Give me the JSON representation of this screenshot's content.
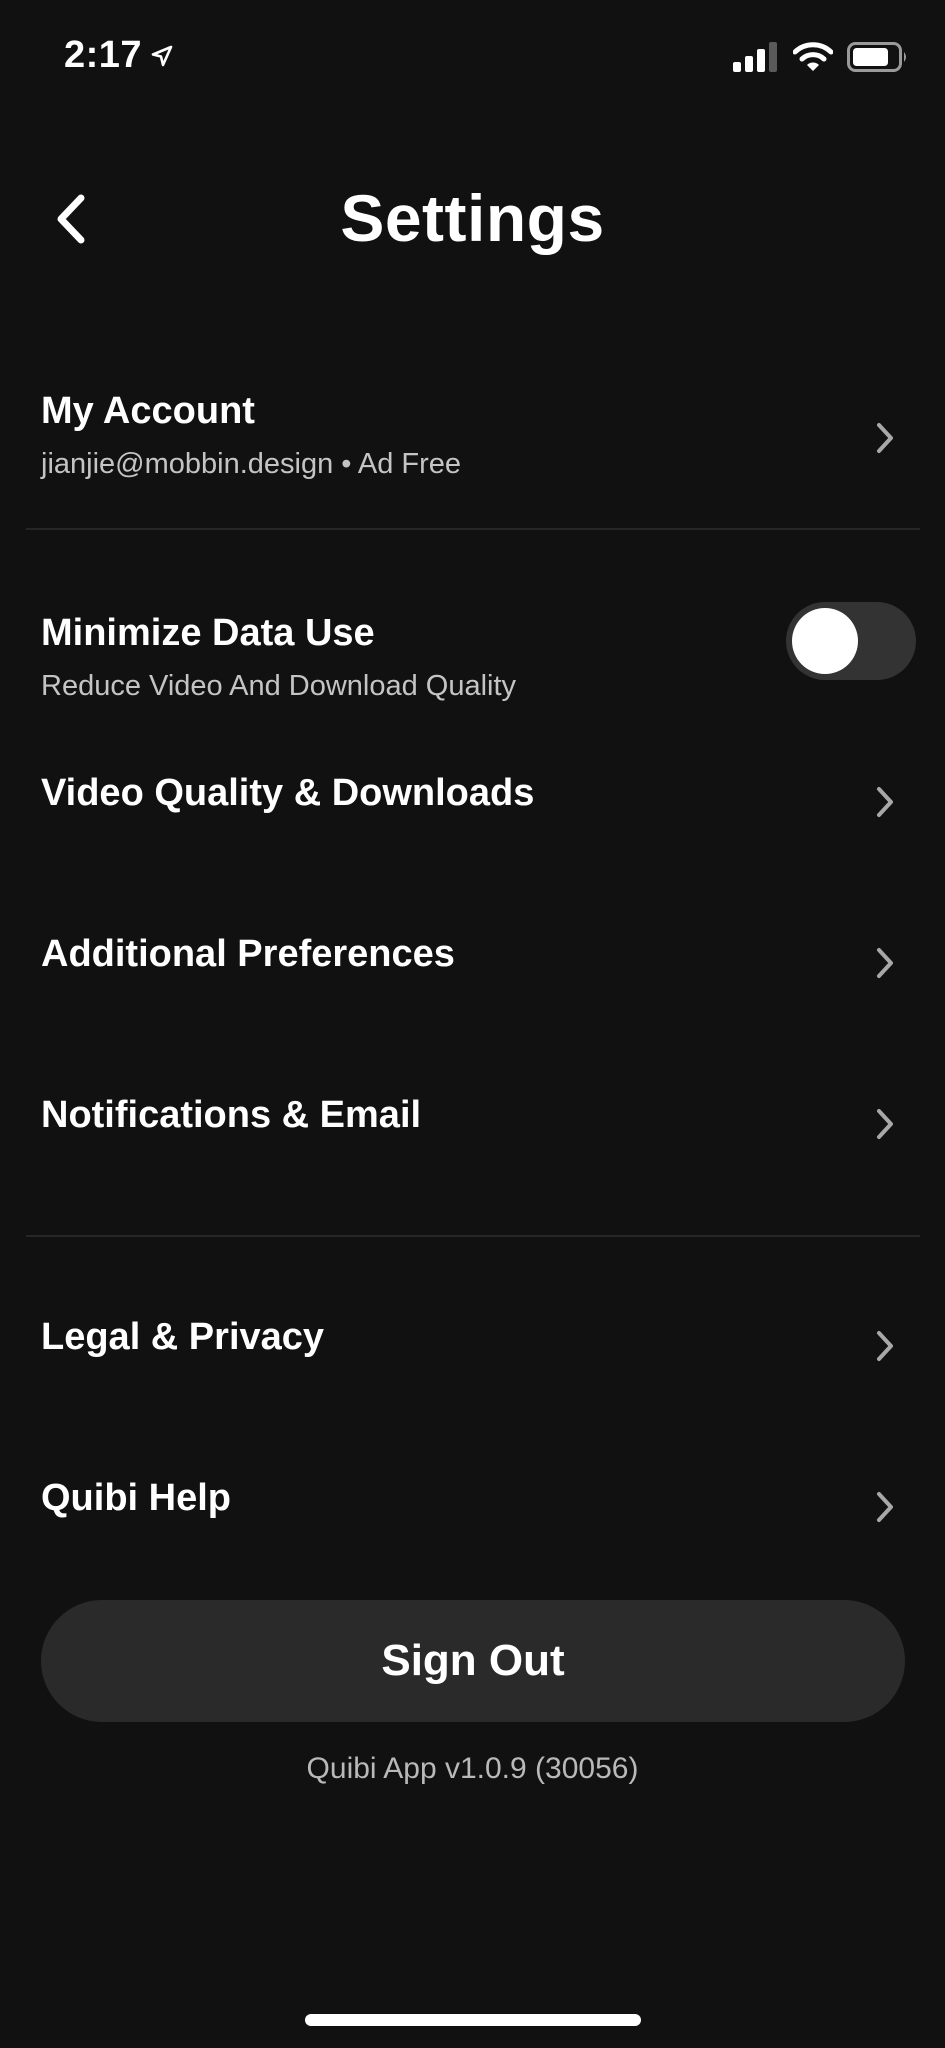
{
  "status_bar": {
    "time": "2:17",
    "location_icon": "location-arrow-icon",
    "signal_icon": "cellular-signal-icon",
    "wifi_icon": "wifi-icon",
    "battery_icon": "battery-icon"
  },
  "header": {
    "title": "Settings",
    "back_icon": "chevron-left-icon"
  },
  "account": {
    "title": "My Account",
    "subtitle": "jianjie@mobbin.design • Ad Free"
  },
  "data_use": {
    "title": "Minimize Data Use",
    "subtitle": "Reduce Video And Download Quality",
    "enabled": false
  },
  "menu": {
    "video_quality": "Video Quality & Downloads",
    "additional_preferences": "Additional Preferences",
    "notifications": "Notifications & Email",
    "legal": "Legal & Privacy",
    "help": "Quibi Help"
  },
  "sign_out": {
    "label": "Sign Out"
  },
  "footer": {
    "version": "Quibi App v1.0.9 (30056)"
  },
  "colors": {
    "background": "#111111",
    "text": "#ffffff",
    "subtext": "#c4c4c4",
    "button_bg": "#2a2a2a",
    "toggle_off": "#333333"
  }
}
